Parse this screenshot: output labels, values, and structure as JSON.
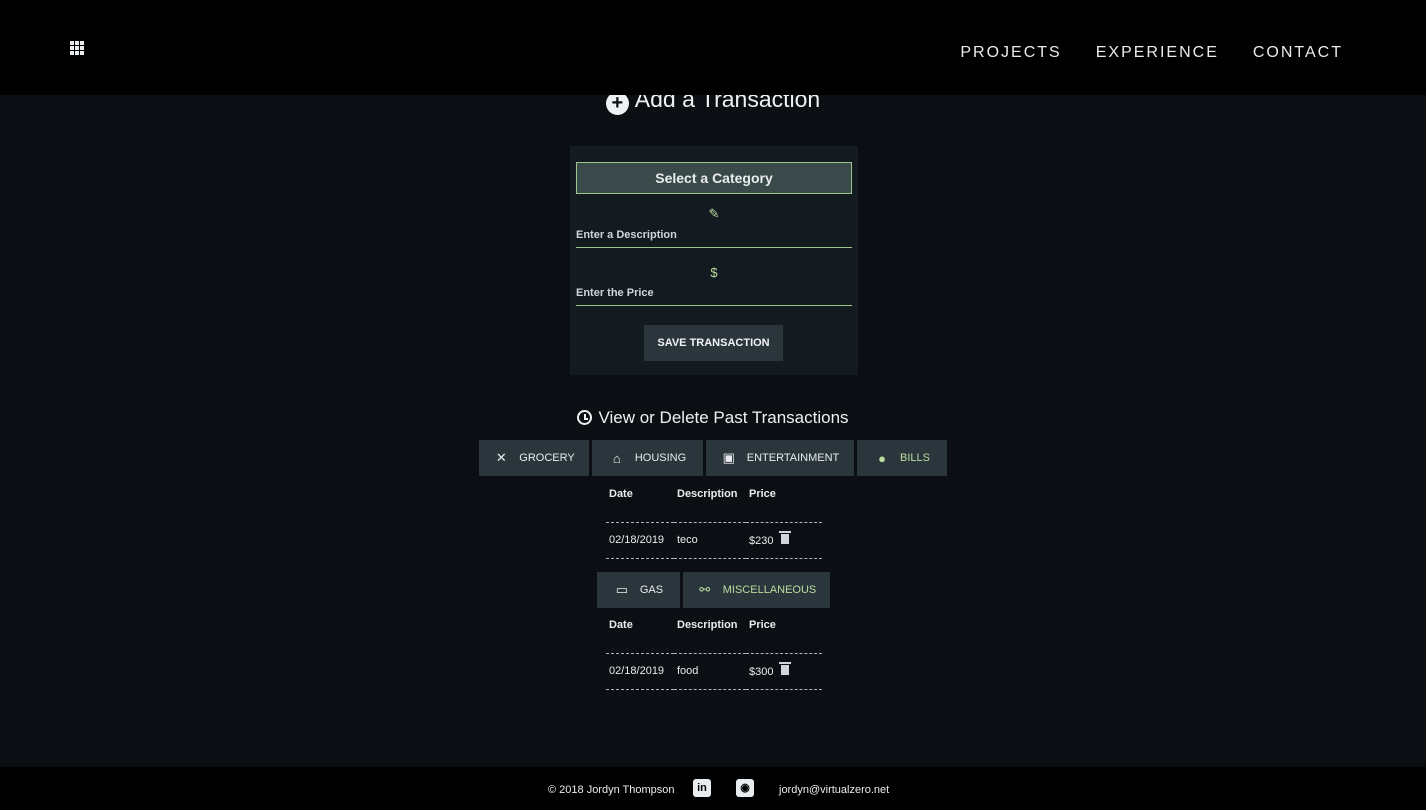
{
  "header": {
    "nav": [
      "PROJECTS",
      "EXPERIENCE",
      "CONTACT"
    ]
  },
  "add_section": {
    "title": "Add a Transaction",
    "category_label": "Select a Category",
    "description_placeholder": "Enter a Description",
    "price_placeholder": "Enter the Price",
    "save_label": "SAVE TRANSACTION"
  },
  "past_section": {
    "title": "View or Delete Past Transactions",
    "tabs_row1": [
      {
        "label": "GROCERY",
        "icon": "utensils-icon",
        "active": false
      },
      {
        "label": "HOUSING",
        "icon": "home-icon",
        "active": false
      },
      {
        "label": "ENTERTAINMENT",
        "icon": "ticket-icon",
        "active": false
      },
      {
        "label": "BILLS",
        "icon": "dollar-circle-icon",
        "active": true
      }
    ],
    "tabs_row2": [
      {
        "label": "GAS",
        "icon": "car-icon",
        "active": false
      },
      {
        "label": "MISCELLANEOUS",
        "icon": "misc-icon",
        "active": true
      }
    ],
    "columns": [
      "Date",
      "Description",
      "Price"
    ],
    "table1_rows": [
      {
        "date": "02/18/2019",
        "description": "teco",
        "price": "$230"
      }
    ],
    "table2_rows": [
      {
        "date": "02/18/2019",
        "description": "food",
        "price": "$300"
      }
    ]
  },
  "footer": {
    "copyright": "© 2018 Jordyn Thompson",
    "linkedin_glyph": "in",
    "email": "jordyn@virtualzero.net"
  },
  "colors": {
    "accent": "#9bc58c",
    "panel": "#141b20",
    "tab_bg": "#2b363c",
    "page_bg": "#0b0f13"
  }
}
